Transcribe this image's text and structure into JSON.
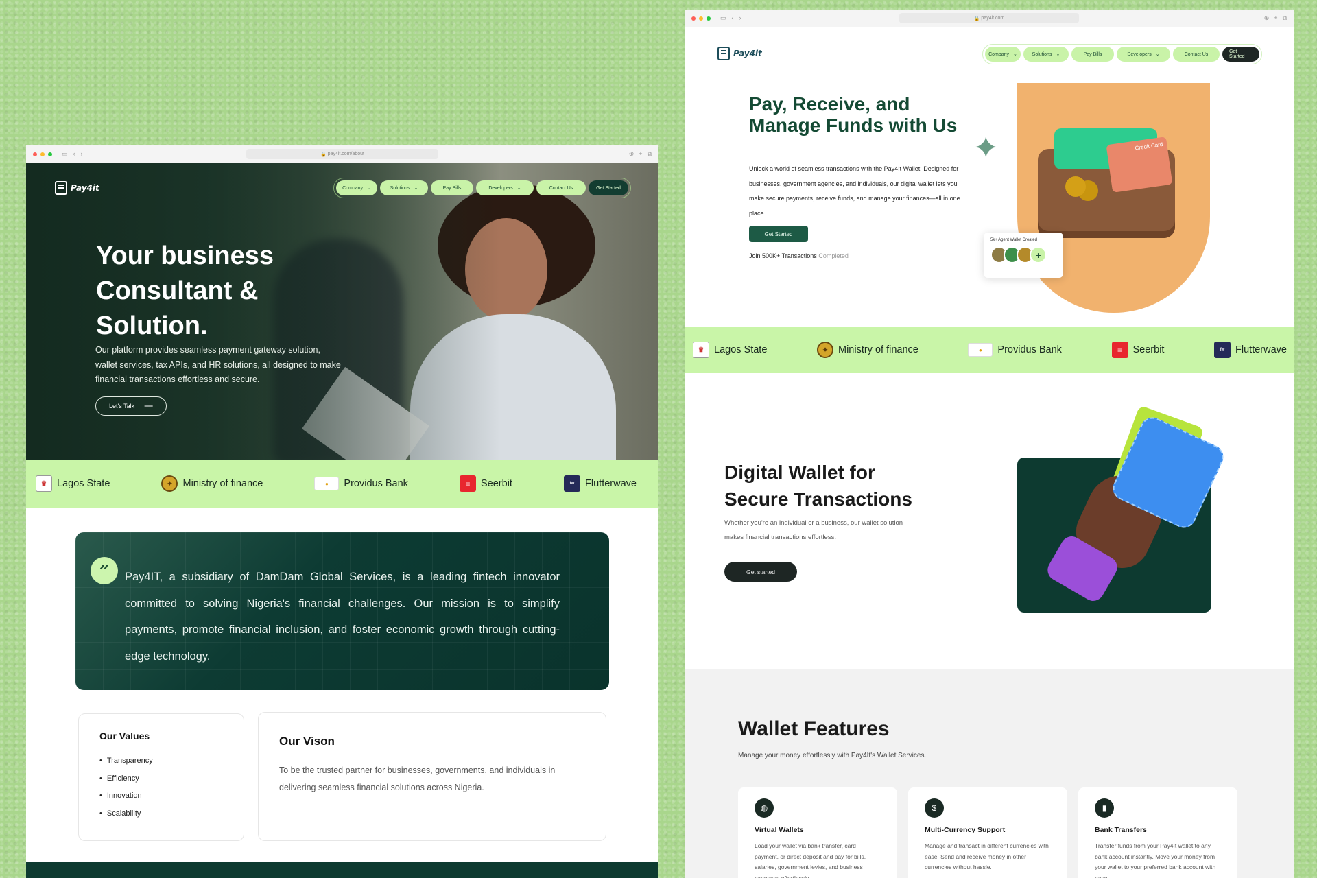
{
  "left": {
    "url": "pay4it.com/about",
    "logo_text": "Pay4it",
    "nav": [
      {
        "label": "Company",
        "dropdown": true
      },
      {
        "label": "Solutions",
        "dropdown": true
      },
      {
        "label": "Pay Bills",
        "dropdown": false
      },
      {
        "label": "Developers",
        "dropdown": true
      },
      {
        "label": "Contact Us",
        "dropdown": false
      }
    ],
    "cta": "Get Started",
    "hero_title": "Your business Consultant & Solution.",
    "hero_text": "Our platform provides seamless payment gateway solution, wallet services, tax APIs, and HR solutions, all designed to make financial transactions effortless and secure.",
    "hero_button": "Let's Talk",
    "quote": "Pay4IT, a subsidiary of DamDam Global Services, is a leading fintech innovator committed to solving Nigeria's financial challenges. Our mission is to simplify payments, promote financial inclusion, and foster economic growth through cutting-edge technology.",
    "values_title": "Our Values",
    "values": [
      "Transparency",
      "Efficiency",
      "Innovation",
      "Scalability"
    ],
    "vision_title": "Our Vison",
    "vision_text": "To be the trusted partner for businesses, governments, and individuals in delivering seamless financial solutions across Nigeria."
  },
  "partners": [
    "Lagos State",
    "Ministry of finance",
    "Providus Bank",
    "Seerbit",
    "Flutterwave"
  ],
  "right": {
    "url": "pay4it.com",
    "logo_text": "Pay4it",
    "nav": [
      {
        "label": "Company",
        "dropdown": true
      },
      {
        "label": "Solutions",
        "dropdown": true
      },
      {
        "label": "Pay Bills",
        "dropdown": false
      },
      {
        "label": "Developers",
        "dropdown": true
      },
      {
        "label": "Contact Us",
        "dropdown": false
      }
    ],
    "cta": "Get Started",
    "hero_title": "Pay, Receive, and Manage Funds with Us",
    "hero_text": "Unlock a world of seamless transactions with the Pay4It Wallet. Designed for businesses, government agencies, and individuals, our digital wallet lets you make secure payments, receive funds, and manage your finances—all in one place.",
    "hero_button": "Get Started",
    "join_link": "Join 500K+ Transactions",
    "join_suffix": "Completed",
    "credit_card_label": "Credit Card",
    "agent_label": "5k+ Agent Wallet Created",
    "section_title": "Digital Wallet for Secure Transactions",
    "section_text": "Whether you're an individual or a business, our wallet solution makes financial transactions effortless.",
    "section_button": "Get started",
    "features_title": "Wallet Features",
    "features_sub": "Manage your money effortlessly with Pay4It's Wallet Services.",
    "features": [
      {
        "icon": "globe-card-icon",
        "title": "Virtual Wallets",
        "text": "Load your wallet via bank transfer, card payment, or direct deposit and pay for bills, salaries, government levies, and business expenses effortlessly."
      },
      {
        "icon": "currency-icon",
        "title": "Multi-Currency Support",
        "text": "Manage and transact in different currencies with ease. Send and receive money in other currencies without hassle."
      },
      {
        "icon": "cards-icon",
        "title": "Bank Transfers",
        "text": "Transfer funds from your Pay4It wallet to any bank account instantly. Move your money from your wallet to your preferred bank account with ease"
      }
    ]
  }
}
